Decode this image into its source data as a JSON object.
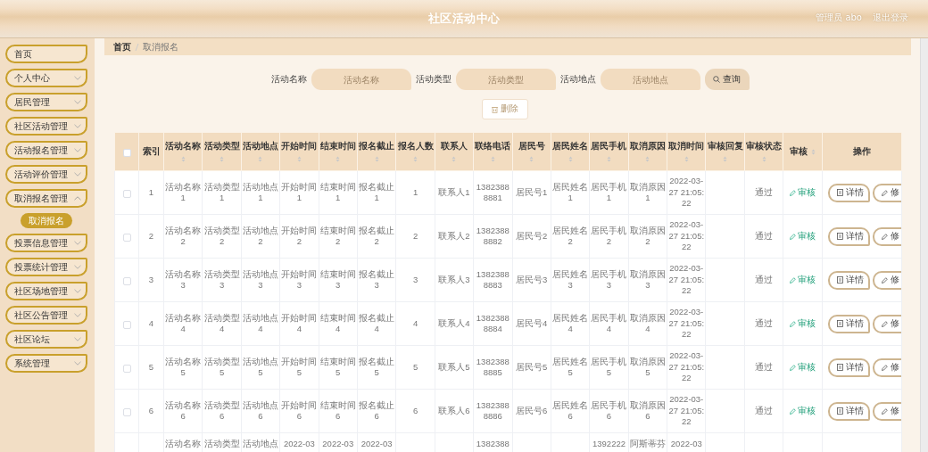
{
  "header": {
    "title": "社区活动中心",
    "user": "管理员 abo",
    "logout": "退出登录"
  },
  "sidebar": {
    "items": [
      {
        "label": "首页",
        "kind": "link"
      },
      {
        "label": "个人中心",
        "kind": "group",
        "expanded": false
      },
      {
        "label": "居民管理",
        "kind": "group",
        "expanded": false
      },
      {
        "label": "社区活动管理",
        "kind": "group",
        "expanded": false
      },
      {
        "label": "活动报名管理",
        "kind": "group",
        "expanded": false
      },
      {
        "label": "活动评价管理",
        "kind": "group",
        "expanded": false
      },
      {
        "label": "取消报名管理",
        "kind": "group",
        "expanded": true,
        "children": [
          {
            "label": "取消报名",
            "selected": true
          }
        ]
      },
      {
        "label": "投票信息管理",
        "kind": "group",
        "expanded": false
      },
      {
        "label": "投票统计管理",
        "kind": "group",
        "expanded": false
      },
      {
        "label": "社区场地管理",
        "kind": "group",
        "expanded": false
      },
      {
        "label": "社区公告管理",
        "kind": "group",
        "expanded": false
      },
      {
        "label": "社区论坛",
        "kind": "group",
        "expanded": false
      },
      {
        "label": "系统管理",
        "kind": "group",
        "expanded": false
      }
    ]
  },
  "breadcrumb": [
    "首页",
    "取消报名"
  ],
  "search": {
    "fields": [
      {
        "label": "活动名称",
        "placeholder": "活动名称"
      },
      {
        "label": "活动类型",
        "placeholder": "活动类型"
      },
      {
        "label": "活动地点",
        "placeholder": "活动地点"
      }
    ],
    "button": "查询"
  },
  "toolbar": {
    "delete_button": {
      "label": "删除",
      "disabled": true
    }
  },
  "table": {
    "select_all_checked": false,
    "columns": [
      {
        "label": "索引",
        "kind": "text",
        "sortable": false
      },
      {
        "label": "活动名称",
        "kind": "text",
        "sortable": true
      },
      {
        "label": "活动类型",
        "kind": "text",
        "sortable": true
      },
      {
        "label": "活动地点",
        "kind": "text",
        "sortable": true
      },
      {
        "label": "开始时间",
        "kind": "text",
        "sortable": true
      },
      {
        "label": "结束时间",
        "kind": "text",
        "sortable": true
      },
      {
        "label": "报名截止",
        "kind": "text",
        "sortable": true
      },
      {
        "label": "报名人数",
        "kind": "text",
        "sortable": true
      },
      {
        "label": "联系人",
        "kind": "text",
        "sortable": true
      },
      {
        "label": "联络电话",
        "kind": "text",
        "sortable": true
      },
      {
        "label": "居民号",
        "kind": "text",
        "sortable": true
      },
      {
        "label": "居民姓名",
        "kind": "text",
        "sortable": true
      },
      {
        "label": "居民手机",
        "kind": "text",
        "sortable": true
      },
      {
        "label": "取消原因",
        "kind": "text",
        "sortable": true
      },
      {
        "label": "取消时间",
        "kind": "text",
        "sortable": true
      },
      {
        "label": "审核回复",
        "kind": "text",
        "sortable": true
      },
      {
        "label": "审核状态",
        "kind": "text",
        "sortable": true
      },
      {
        "label": "审核",
        "kind": "audit",
        "sortable": true
      },
      {
        "label": "操作",
        "kind": "actions",
        "sortable": false
      }
    ],
    "rows": [
      {
        "checked": false,
        "cut": false,
        "cells": [
          "1",
          "活动名称1",
          "活动类型1",
          "活动地点1",
          "开始时间1",
          "结束时间1",
          "报名截止1",
          "1",
          "联系人1",
          "13823888881",
          "居民号1",
          "居民姓名1",
          "居民手机1",
          "取消原因1",
          "2022-03-27 21:05:22",
          null,
          "通过"
        ],
        "audit": "审核",
        "actions": [
          "详情",
          "修"
        ]
      },
      {
        "checked": false,
        "cut": false,
        "cells": [
          "2",
          "活动名称2",
          "活动类型2",
          "活动地点2",
          "开始时间2",
          "结束时间2",
          "报名截止2",
          "2",
          "联系人2",
          "13823888882",
          "居民号2",
          "居民姓名2",
          "居民手机2",
          "取消原因2",
          "2022-03-27 21:05:22",
          null,
          "通过"
        ],
        "audit": "审核",
        "actions": [
          "详情",
          "修"
        ]
      },
      {
        "checked": false,
        "cut": false,
        "cells": [
          "3",
          "活动名称3",
          "活动类型3",
          "活动地点3",
          "开始时间3",
          "结束时间3",
          "报名截止3",
          "3",
          "联系人3",
          "13823888883",
          "居民号3",
          "居民姓名3",
          "居民手机3",
          "取消原因3",
          "2022-03-27 21:05:22",
          null,
          "通过"
        ],
        "audit": "审核",
        "actions": [
          "详情",
          "修"
        ]
      },
      {
        "checked": false,
        "cut": false,
        "cells": [
          "4",
          "活动名称4",
          "活动类型4",
          "活动地点4",
          "开始时间4",
          "结束时间4",
          "报名截止4",
          "4",
          "联系人4",
          "13823888884",
          "居民号4",
          "居民姓名4",
          "居民手机4",
          "取消原因4",
          "2022-03-27 21:05:22",
          null,
          "通过"
        ],
        "audit": "审核",
        "actions": [
          "详情",
          "修"
        ]
      },
      {
        "checked": false,
        "cut": false,
        "cells": [
          "5",
          "活动名称5",
          "活动类型5",
          "活动地点5",
          "开始时间5",
          "结束时间5",
          "报名截止5",
          "5",
          "联系人5",
          "13823888885",
          "居民号5",
          "居民姓名5",
          "居民手机5",
          "取消原因5",
          "2022-03-27 21:05:22",
          null,
          "通过"
        ],
        "audit": "审核",
        "actions": [
          "详情",
          "修"
        ]
      },
      {
        "checked": false,
        "cut": false,
        "cells": [
          "6",
          "活动名称6",
          "活动类型6",
          "活动地点6",
          "开始时间6",
          "结束时间6",
          "报名截止6",
          "6",
          "联系人6",
          "13823888886",
          "居民号6",
          "居民姓名6",
          "居民手机6",
          "取消原因6",
          "2022-03-27 21:05:22",
          null,
          "通过"
        ],
        "audit": "审核",
        "actions": [
          "详情",
          "修"
        ]
      },
      {
        "cut": true,
        "cells": [
          null,
          "活动名称",
          "活动类型",
          "活动地点",
          "2022-03",
          "2022-03",
          "2022-03",
          null,
          null,
          "1382388",
          null,
          null,
          "1392222",
          "阿斯蒂芬",
          "2022-03",
          null,
          null
        ]
      }
    ]
  }
}
